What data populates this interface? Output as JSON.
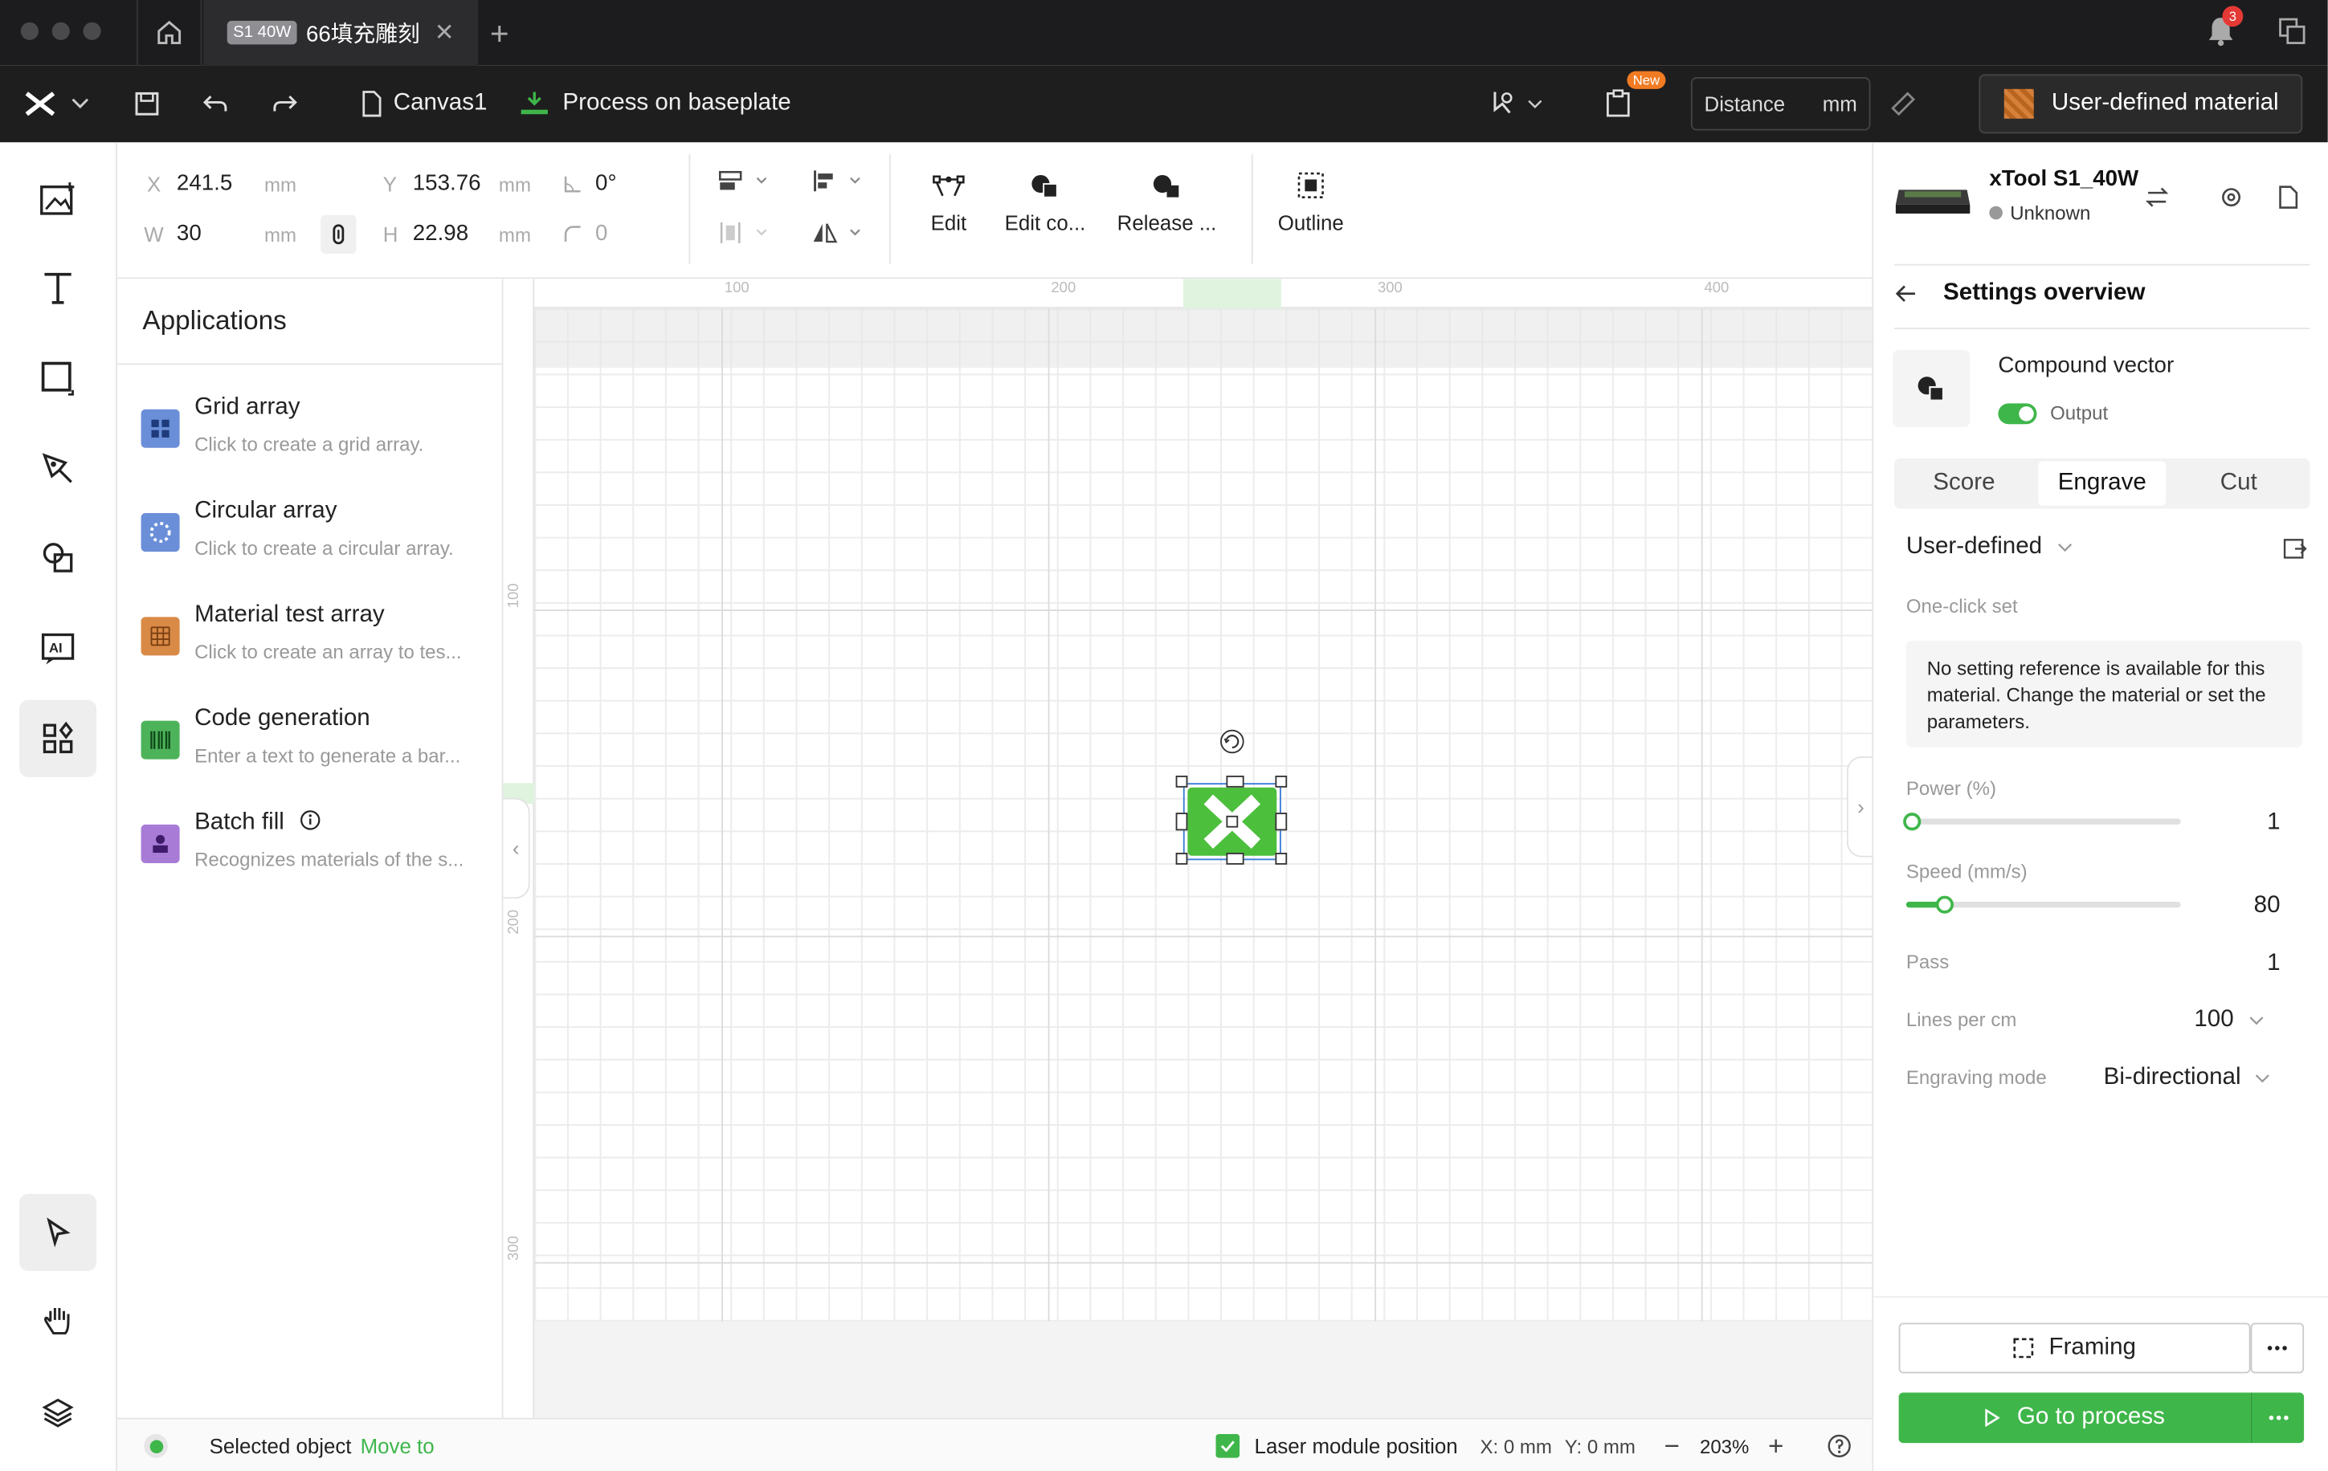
{
  "titlebar": {
    "tab_badge": "S1 40W",
    "tab_title": "66填充雕刻",
    "notification_count": "3"
  },
  "toolbar": {
    "canvas_name": "Canvas1",
    "process_label": "Process on baseplate",
    "new_badge": "New",
    "distance_label": "Distance",
    "distance_unit": "mm",
    "material_label": "User-defined material"
  },
  "props": {
    "x_label": "X",
    "x_value": "241.5",
    "x_unit": "mm",
    "y_label": "Y",
    "y_value": "153.76",
    "y_unit": "mm",
    "w_label": "W",
    "w_value": "30",
    "w_unit": "mm",
    "h_label": "H",
    "h_value": "22.98",
    "h_unit": "mm",
    "angle_value": "0°",
    "radius_value": "0",
    "actions": [
      "Edit",
      "Edit co...",
      "Release ...",
      "Outline"
    ]
  },
  "applications": {
    "title": "Applications",
    "items": [
      {
        "name": "Grid array",
        "desc": "Click to create a grid array.",
        "color": "#6a8fd8"
      },
      {
        "name": "Circular array",
        "desc": "Click to create a circular array.",
        "color": "#6a8fd8"
      },
      {
        "name": "Material test array",
        "desc": "Click to create an array to tes...",
        "color": "#d98a46"
      },
      {
        "name": "Code generation",
        "desc": "Enter a text to generate a bar...",
        "color": "#4db35a"
      },
      {
        "name": "Batch fill",
        "desc": "Recognizes materials of the s...",
        "color": "#a77bd6"
      }
    ]
  },
  "canvas": {
    "ruler_top": [
      "100",
      "200",
      "300",
      "400"
    ],
    "ruler_left": [
      "100",
      "200",
      "300"
    ]
  },
  "right_panel": {
    "device_name": "xTool S1_40W",
    "device_status": "Unknown",
    "settings_title": "Settings overview",
    "object_type": "Compound vector",
    "output_label": "Output",
    "tabs": [
      "Score",
      "Engrave",
      "Cut"
    ],
    "active_tab": "Engrave",
    "preset": "User-defined",
    "one_click_label": "One-click set",
    "note": "No setting reference is available for this material. Change the material or set the parameters.",
    "power_label": "Power (%)",
    "power_value": "1",
    "power_fraction": 0.01,
    "speed_label": "Speed (mm/s)",
    "speed_value": "80",
    "speed_fraction": 0.14,
    "pass_label": "Pass",
    "pass_value": "1",
    "lines_label": "Lines per cm",
    "lines_value": "100",
    "mode_label": "Engraving mode",
    "mode_value": "Bi-directional",
    "framing_label": "Framing",
    "process_label": "Go to process"
  },
  "status": {
    "selected_label": "Selected object",
    "move_label": "Move to",
    "laser_label": "Laser module position",
    "x_pos": "X: 0 mm",
    "y_pos": "Y: 0 mm",
    "zoom": "203%"
  },
  "colors": {
    "accent": "#3fb64a",
    "dark": "#1e1e1e"
  }
}
